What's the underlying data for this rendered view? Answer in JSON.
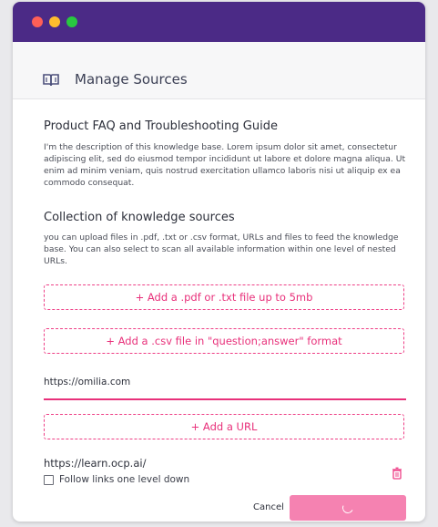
{
  "window": {
    "titlebar_color": "#4b2a86",
    "traffic_lights": [
      "#ff5f57",
      "#febc2e",
      "#28c840"
    ]
  },
  "header": {
    "icon": "book-icon",
    "title": "Manage Sources"
  },
  "knowledge_base": {
    "title": "Product FAQ and Troubleshooting Guide",
    "description": "I'm the description of this knowledge base. Lorem ipsum dolor sit amet, consectetur adipiscing elit, sed do eiusmod tempor incididunt ut labore et dolore magna aliqua. Ut enim ad minim veniam, quis nostrud exercitation ullamco laboris nisi ut aliquip ex ea commodo consequat."
  },
  "collection": {
    "title": "Collection of knowledge sources",
    "description": "you can upload files in .pdf, .txt or .csv format, URLs and files to feed the knowledge base. You can also select to scan all available information within one level of nested URLs."
  },
  "actions": {
    "add_pdf_label": "+ Add a .pdf or .txt file up to 5mb",
    "add_csv_label": "+ Add a .csv file in \"question;answer\" format",
    "add_url_label": "+ Add a URL"
  },
  "url_input": {
    "value": "https://omilia.com",
    "placeholder": ""
  },
  "sources": [
    {
      "url": "https://learn.ocp.ai/",
      "follow_label": "Follow links one level down",
      "follow_checked": false,
      "delete_icon": "trash-icon"
    }
  ],
  "footer": {
    "cancel_label": "Cancel",
    "submit_state": "loading",
    "accent_color": "#e8307a"
  }
}
